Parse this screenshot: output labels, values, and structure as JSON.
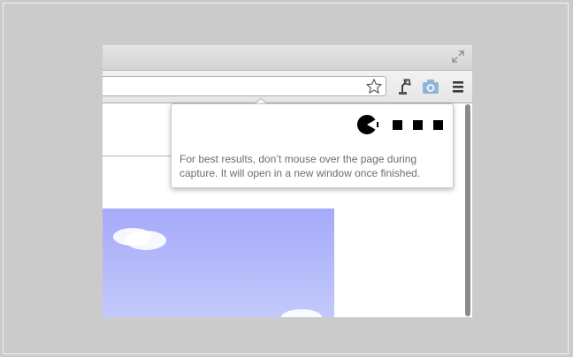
{
  "popup": {
    "message_line1": "For best results, don’t mouse over the page during",
    "message_line2": "capture. It will open in a new window once finished."
  },
  "toolbar": {
    "icons": [
      "star-icon",
      "lamp-extension-icon",
      "camera-icon",
      "menu-icon"
    ]
  },
  "titlebar": {
    "icons": [
      "fullscreen-icon"
    ]
  },
  "colors": {
    "background": "#cbcbcb",
    "sky_top": "#a6aaf9",
    "sky_bottom": "#c2c9fb",
    "camera_icon": "#8fb3d9",
    "popup_text": "#6d6d6d"
  }
}
